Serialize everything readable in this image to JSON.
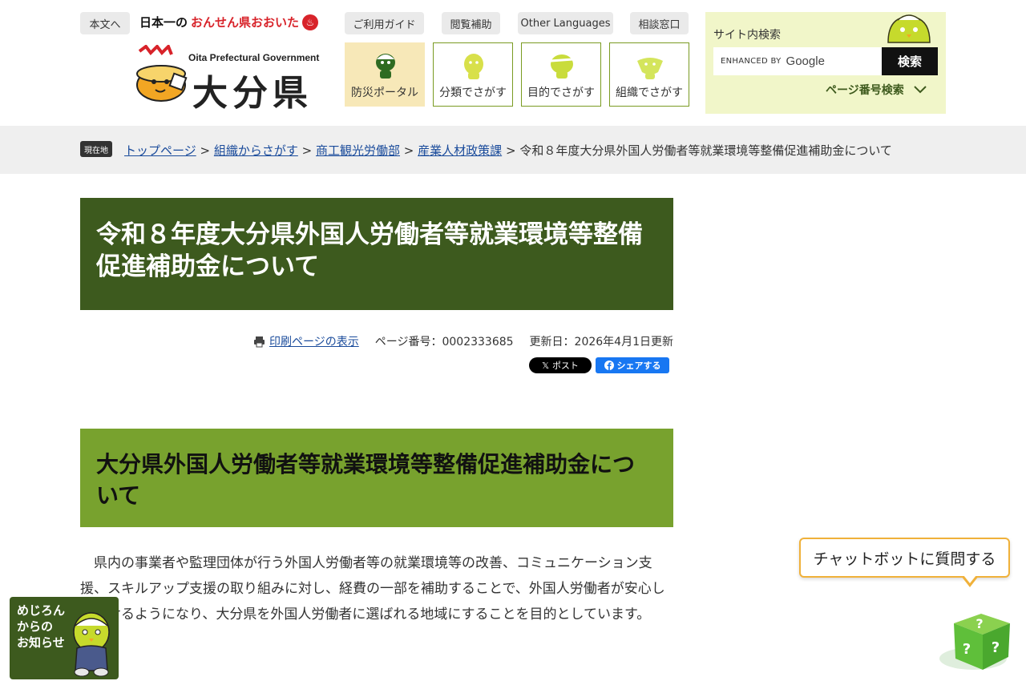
{
  "header": {
    "skip_link": "本文へ",
    "tagline_prefix": "日本一の",
    "tagline_highlight": "おんせん県おおいた",
    "logo_en": "Oita Prefectural Government",
    "logo_ja": "大分県",
    "top_links": [
      "ご利用ガイド",
      "閲覧補助",
      "Other Languages",
      "相談窓口"
    ],
    "nav": [
      "防災ポータル",
      "分類でさがす",
      "目的でさがす",
      "組織でさがす"
    ]
  },
  "search": {
    "title": "サイト内検索",
    "enhanced_by": "ENHANCED BY",
    "google": "Google",
    "button": "検索",
    "page_number_search": "ページ番号検索"
  },
  "breadcrumb": {
    "badge": "現在地",
    "items": [
      "トップページ",
      "組織からさがす",
      "商工観光労働部",
      "産業人材政策課"
    ],
    "current": "令和８年度大分県外国人労働者等就業環境等整備促進補助金について",
    "separator": ">"
  },
  "main": {
    "title": "令和８年度大分県外国人労働者等就業環境等整備促進補助金について",
    "print_link": "印刷ページの表示",
    "page_number": "ページ番号：0002333685",
    "updated": "更新日：2026年4月1日更新",
    "share_x": "ポスト",
    "share_fb": "シェアする",
    "section_title": "大分県外国人労働者等就業環境等整備促進補助金について",
    "body": "県内の事業者や監理団体が行う外国人労働者等の就業環境等の改善、コミュニケーション支援、スキルアップ支援の取り組みに対し、経費の一部を補助することで、外国人労働者が安心して働けるようになり、大分県を外国人労働者に選ばれる地域にすることを目的としています。"
  },
  "floating": {
    "chatbot": "チャットボットに質問する",
    "news": "めじろん\nからの\nお知らせ"
  },
  "colors": {
    "dark_green": "#3d5a1e",
    "light_green": "#78a22e",
    "search_panel": "#f1f6c9",
    "link": "#1a4b9b",
    "accent_red": "#d8232a"
  }
}
